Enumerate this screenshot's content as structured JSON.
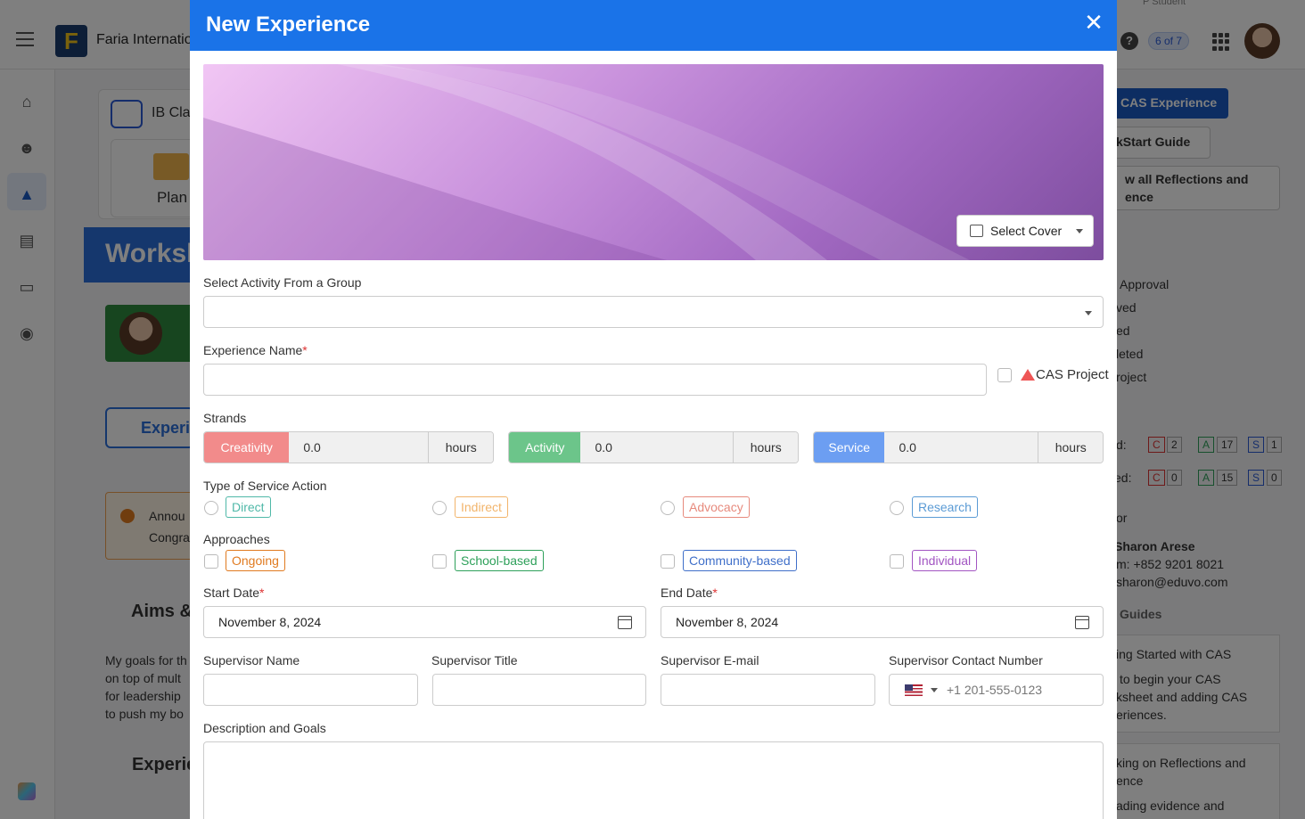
{
  "topbar": {
    "org_name": "Faria Internatio",
    "user_role": "P Student",
    "help": "?",
    "counter": "6 of 7",
    "logo_letter": "F"
  },
  "background": {
    "ib_class": "IB Cla",
    "plan": "Plan",
    "worksheet": "Worksh",
    "experience_tab": "Experi",
    "announcement_title": "Annou",
    "announcement_body": "Congra",
    "aims": "Aims &",
    "goals_lines": [
      "My goals for th",
      "on top of mult",
      "for leadership",
      "to push my bo"
    ],
    "experiences_heading": "Experie",
    "add_cas_button": "CAS Experience",
    "quickstart_button": "kStart Guide",
    "view_all_button_l1": "w all Reflections and",
    "view_all_button_l2": "ence",
    "statuses": [
      "Approval",
      "ved",
      "ed",
      "leted",
      "roject"
    ],
    "counts_row1_label": "d:",
    "counts_row1": [
      "C",
      "2",
      "A",
      "17",
      "S",
      "1"
    ],
    "counts_row2_label": "ed:",
    "counts_row2": [
      "C",
      "0",
      "A",
      "15",
      "S",
      "0"
    ],
    "supervisor_label": "or",
    "supervisor_name": "Sharon Arese",
    "supervisor_phone": "m: +852 9201 8021",
    "supervisor_email": "sharon@eduvo.com",
    "guides_heading": "Guides",
    "guide1_title": "ing Started with CAS",
    "guide1_l1": "to begin your CAS",
    "guide1_l2": "ksheet and adding CAS",
    "guide1_l3": "eriences.",
    "guide2_l1": "king on Reflections and",
    "guide2_l2": "ence",
    "guide2_l3": "ading evidence and"
  },
  "modal": {
    "title": "New Experience",
    "select_cover": "Select Cover",
    "group_label": "Select Activity From a Group",
    "group_value": "",
    "name_label": "Experience Name",
    "name_value": "",
    "cas_project_label": "CAS Project",
    "strands_label": "Strands",
    "strands": [
      {
        "name": "Creativity",
        "value": "0.0",
        "unit": "hours",
        "color": "#f28b8b"
      },
      {
        "name": "Activity",
        "value": "0.0",
        "unit": "hours",
        "color": "#6cc58a"
      },
      {
        "name": "Service",
        "value": "0.0",
        "unit": "hours",
        "color": "#6c9ef2"
      }
    ],
    "service_type_label": "Type of Service Action",
    "service_types": [
      {
        "label": "Direct",
        "color": "#4fb8a8"
      },
      {
        "label": "Indirect",
        "color": "#f2b46b"
      },
      {
        "label": "Advocacy",
        "color": "#e78a7d"
      },
      {
        "label": "Research",
        "color": "#5b9bd5"
      }
    ],
    "approaches_label": "Approaches",
    "approaches": [
      {
        "label": "Ongoing",
        "color": "#e07a1f"
      },
      {
        "label": "School-based",
        "color": "#2ea05a"
      },
      {
        "label": "Community-based",
        "color": "#3f6fc9"
      },
      {
        "label": "Individual",
        "color": "#a255c2"
      }
    ],
    "start_label": "Start Date",
    "start_value": "November 8, 2024",
    "end_label": "End Date",
    "end_value": "November 8, 2024",
    "sup_name_label": "Supervisor Name",
    "sup_title_label": "Supervisor Title",
    "sup_email_label": "Supervisor E-mail",
    "sup_contact_label": "Supervisor Contact Number",
    "phone_placeholder": "+1 201-555-0123",
    "desc_label": "Description and Goals",
    "required_mark": "*"
  }
}
